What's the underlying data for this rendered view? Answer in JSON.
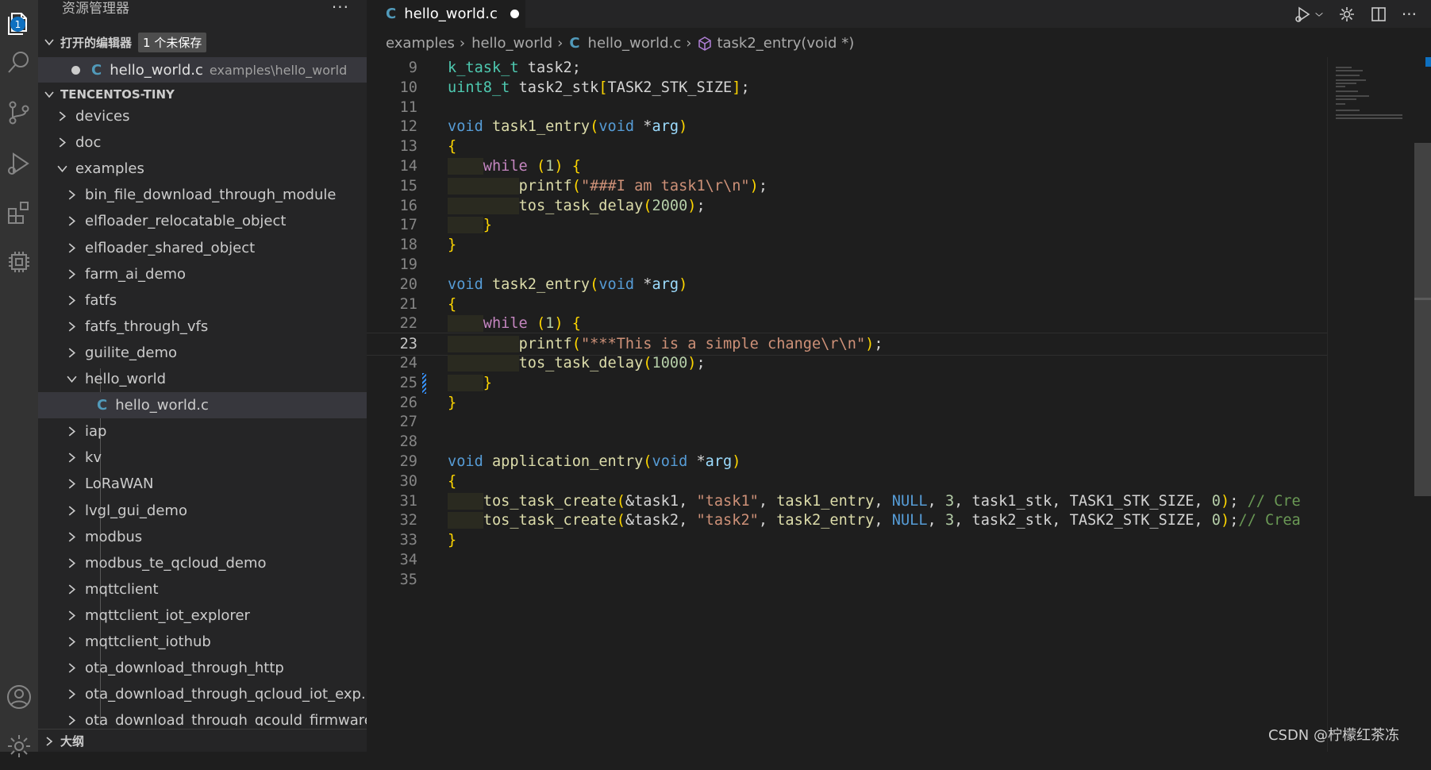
{
  "sidebar": {
    "title": "资源管理器",
    "more": "···",
    "open_editors_label": "打开的编辑器",
    "unsaved_badge": "1 个未保存",
    "open_file": {
      "name": "hello_world.c",
      "path": "examples\\hello_world",
      "icon": "C"
    },
    "workspace_label": "TENCENTOS-TINY",
    "outline_label": "大纲",
    "tree": [
      {
        "label": "devices",
        "expanded": false
      },
      {
        "label": "doc",
        "expanded": false
      },
      {
        "label": "examples",
        "expanded": true
      },
      {
        "label": "bin_file_download_through_module",
        "expanded": false
      },
      {
        "label": "elfloader_relocatable_object",
        "expanded": false
      },
      {
        "label": "elfloader_shared_object",
        "expanded": false
      },
      {
        "label": "farm_ai_demo",
        "expanded": false
      },
      {
        "label": "fatfs",
        "expanded": false
      },
      {
        "label": "fatfs_through_vfs",
        "expanded": false
      },
      {
        "label": "guilite_demo",
        "expanded": false
      },
      {
        "label": "hello_world",
        "expanded": true
      },
      {
        "label": "hello_world.c",
        "icon": "C"
      },
      {
        "label": "iap",
        "expanded": false
      },
      {
        "label": "kv",
        "expanded": false
      },
      {
        "label": "LoRaWAN",
        "expanded": false
      },
      {
        "label": "lvgl_gui_demo",
        "expanded": false
      },
      {
        "label": "modbus",
        "expanded": false
      },
      {
        "label": "modbus_te_qcloud_demo",
        "expanded": false
      },
      {
        "label": "mqttclient",
        "expanded": false
      },
      {
        "label": "mqttclient_iot_explorer",
        "expanded": false
      },
      {
        "label": "mqttclient_iothub",
        "expanded": false
      },
      {
        "label": "ota_download_through_http",
        "expanded": false
      },
      {
        "label": "ota_download_through_qcloud_iot_exp...",
        "expanded": false
      },
      {
        "label": "ota_download_through_qcould_firmware",
        "expanded": false
      }
    ]
  },
  "activity": {
    "badge": "1"
  },
  "tab": {
    "name": "hello_world.c",
    "icon": "C",
    "dirty": true
  },
  "breadcrumb": {
    "part1": "examples",
    "part2": "hello_world",
    "file": "hello_world.c",
    "symbol": "task2_entry(void *)",
    "sep": "›"
  },
  "editor": {
    "current_line": 23,
    "lines": [
      {
        "n": "9",
        "text": "k_task_t task2;"
      },
      {
        "n": "10",
        "text": "uint8_t task2_stk[TASK2_STK_SIZE];"
      },
      {
        "n": "11",
        "text": ""
      },
      {
        "n": "12",
        "text": "void task1_entry(void *arg)"
      },
      {
        "n": "13",
        "text": "{"
      },
      {
        "n": "14",
        "text": "    while (1) {"
      },
      {
        "n": "15",
        "text": "        printf(\"###I am task1\\r\\n\");"
      },
      {
        "n": "16",
        "text": "        tos_task_delay(2000);"
      },
      {
        "n": "17",
        "text": "    }"
      },
      {
        "n": "18",
        "text": "}"
      },
      {
        "n": "19",
        "text": ""
      },
      {
        "n": "20",
        "text": "void task2_entry(void *arg)"
      },
      {
        "n": "21",
        "text": "{"
      },
      {
        "n": "22",
        "text": "    while (1) {"
      },
      {
        "n": "23",
        "text": "        printf(\"***This is a simple change\\r\\n\");"
      },
      {
        "n": "24",
        "text": "        tos_task_delay(1000);"
      },
      {
        "n": "25",
        "text": "    }"
      },
      {
        "n": "26",
        "text": "}"
      },
      {
        "n": "27",
        "text": ""
      },
      {
        "n": "28",
        "text": ""
      },
      {
        "n": "29",
        "text": "void application_entry(void *arg)"
      },
      {
        "n": "30",
        "text": "{"
      },
      {
        "n": "31",
        "text": "    tos_task_create(&task1, \"task1\", task1_entry, NULL, 3, task1_stk, TASK1_STK_SIZE, 0); // Cre"
      },
      {
        "n": "32",
        "text": "    tos_task_create(&task2, \"task2\", task2_entry, NULL, 3, task2_stk, TASK2_STK_SIZE, 0);// Crea"
      },
      {
        "n": "33",
        "text": "}"
      },
      {
        "n": "34",
        "text": ""
      },
      {
        "n": "35",
        "text": ""
      }
    ]
  },
  "watermark": "CSDN @柠檬红茶冻",
  "colors": {
    "accent": "#0e70c0",
    "c_icon": "#519aba",
    "editor_bg": "#1e1e1e",
    "sidebar_bg": "#252526"
  }
}
